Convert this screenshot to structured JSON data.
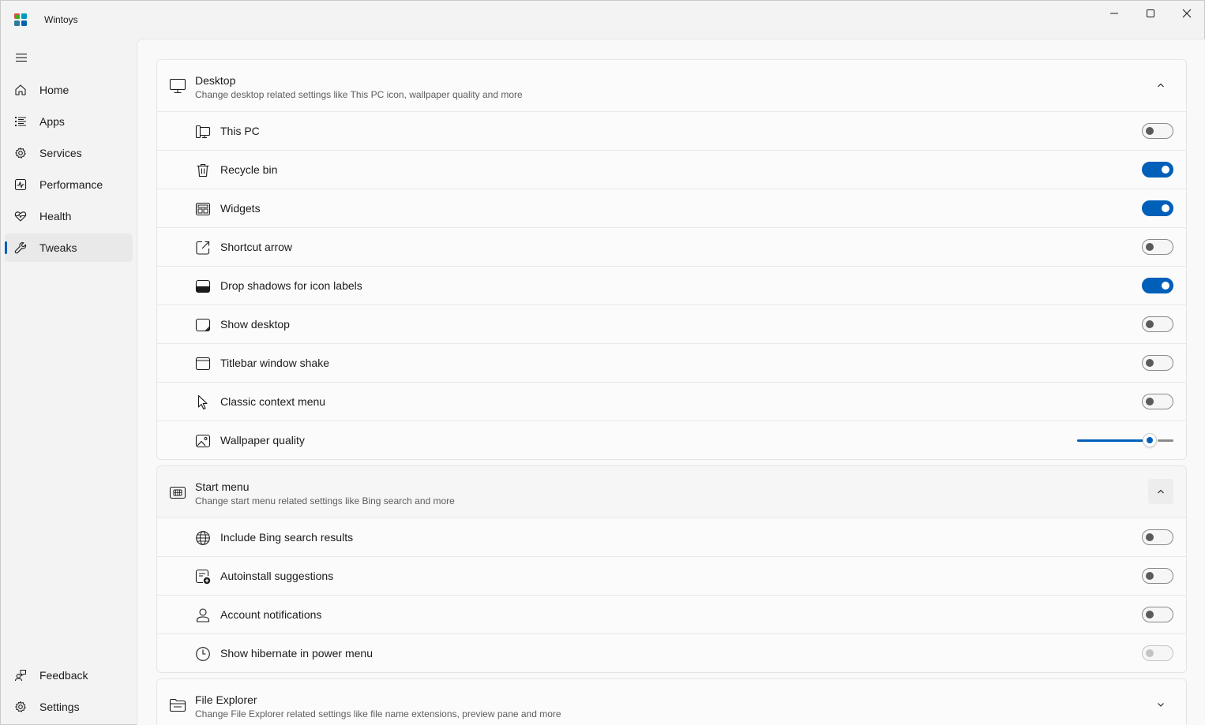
{
  "app": {
    "title": "Wintoys"
  },
  "window_controls": {
    "minimize": "minimize-icon",
    "maximize": "maximize-icon",
    "close": "close-icon"
  },
  "sidebar": {
    "menu_icon": "hamburger-icon",
    "items": [
      {
        "label": "Home",
        "icon": "home-icon",
        "selected": false
      },
      {
        "label": "Apps",
        "icon": "apps-list-icon",
        "selected": false
      },
      {
        "label": "Services",
        "icon": "services-gear-icon",
        "selected": false
      },
      {
        "label": "Performance",
        "icon": "performance-chart-icon",
        "selected": false
      },
      {
        "label": "Health",
        "icon": "heart-pulse-icon",
        "selected": false
      },
      {
        "label": "Tweaks",
        "icon": "wrench-icon",
        "selected": true
      }
    ],
    "footer_items": [
      {
        "label": "Feedback",
        "icon": "feedback-person-icon"
      },
      {
        "label": "Settings",
        "icon": "settings-gear-icon"
      }
    ]
  },
  "groups": {
    "desktop": {
      "title": "Desktop",
      "description": "Change desktop related settings like This PC icon, wallpaper quality and more",
      "expanded": true,
      "icon": "monitor-icon",
      "rows": [
        {
          "label": "This PC",
          "icon": "this-pc-icon",
          "type": "toggle",
          "on": false
        },
        {
          "label": "Recycle bin",
          "icon": "recycle-bin-icon",
          "type": "toggle",
          "on": true
        },
        {
          "label": "Widgets",
          "icon": "widgets-icon",
          "type": "toggle",
          "on": true
        },
        {
          "label": "Shortcut arrow",
          "icon": "shortcut-arrow-icon",
          "type": "toggle",
          "on": false
        },
        {
          "label": "Drop shadows for icon labels",
          "icon": "drop-shadow-icon",
          "type": "toggle",
          "on": true
        },
        {
          "label": "Show desktop",
          "icon": "show-desktop-icon",
          "type": "toggle",
          "on": false
        },
        {
          "label": "Titlebar window shake",
          "icon": "window-icon",
          "type": "toggle",
          "on": false
        },
        {
          "label": "Classic context menu",
          "icon": "cursor-icon",
          "type": "toggle",
          "on": false
        },
        {
          "label": "Wallpaper quality",
          "icon": "image-icon",
          "type": "slider",
          "value": 0.8
        }
      ]
    },
    "start_menu": {
      "title": "Start menu",
      "description": "Change start menu related settings like Bing search and more",
      "expanded": true,
      "icon": "start-menu-icon",
      "rows": [
        {
          "label": "Include Bing search results",
          "icon": "globe-icon",
          "type": "toggle",
          "on": false
        },
        {
          "label": "Autoinstall suggestions",
          "icon": "app-add-icon",
          "type": "toggle",
          "on": false
        },
        {
          "label": "Account notifications",
          "icon": "person-icon",
          "type": "toggle",
          "on": false
        },
        {
          "label": "Show hibernate in power menu",
          "icon": "clock-icon",
          "type": "toggle",
          "on": false,
          "disabled": true
        }
      ]
    },
    "file_explorer": {
      "title": "File Explorer",
      "description": "Change File Explorer related settings like file name extensions, preview pane and more",
      "expanded": false,
      "icon": "folder-icon"
    }
  },
  "colors": {
    "accent": "#005fb8",
    "background": "#f3f3f3",
    "card": "#fbfbfb"
  }
}
